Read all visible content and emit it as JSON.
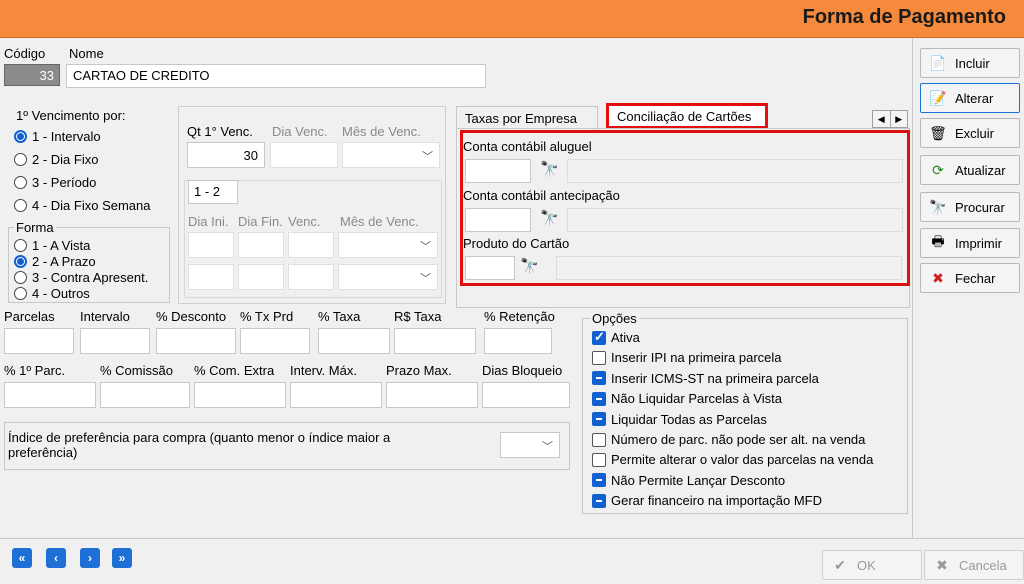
{
  "title": "Forma de Pagamento",
  "codigo": {
    "label": "Código",
    "value": "33"
  },
  "nome": {
    "label": "Nome",
    "value": "CARTAO DE CREDITO"
  },
  "vencimento": {
    "label": "1º Vencimento por:",
    "options": [
      "1 - Intervalo",
      "2 - Dia Fixo",
      "3 - Período",
      "4 - Dia Fixo Semana"
    ],
    "selected": 0
  },
  "forma": {
    "label": "Forma",
    "options": [
      "1 - A Vista",
      "2 - A Prazo",
      "3 - Contra Apresent.",
      "4 - Outros"
    ],
    "selected": 1
  },
  "qt_venc": {
    "label": "Qt 1° Venc.",
    "value": "30"
  },
  "dia_venc_label": "Dia Venc.",
  "mes_venc_label": "Mês de Venc.",
  "range_value": "1 - 2",
  "dia_ini_label": "Dia Ini.",
  "dia_fin_label": "Dia Fin.",
  "venc_label": "Venc.",
  "mes_venc2_label": "Mês de Venc.",
  "row1_labels": [
    "Parcelas",
    "Intervalo",
    "% Desconto",
    "% Tx Prd",
    "% Taxa",
    "R$ Taxa",
    "% Retenção"
  ],
  "row2_labels": [
    "% 1º Parc.",
    "% Comissão",
    "% Com. Extra",
    "Interv. Máx.",
    "Prazo Max.",
    "Dias Bloqueio"
  ],
  "indice_label": "Índice de preferência para compra (quanto menor o índice maior a preferência)",
  "tabs": [
    "Taxas por Empresa",
    "Conciliação de Cartões"
  ],
  "conciliacao": {
    "conta_aluguel": "Conta contábil aluguel",
    "conta_antecipacao": "Conta contábil antecipação",
    "produto": "Produto do Cartão"
  },
  "opcoes": {
    "label": "Opções",
    "items": [
      {
        "label": "Ativa",
        "state": "checked"
      },
      {
        "label": "Inserir IPI na primeira parcela",
        "state": "unchecked"
      },
      {
        "label": "Inserir ICMS-ST na primeira parcela",
        "state": "indeterminate"
      },
      {
        "label": "Não Liquidar Parcelas à Vista",
        "state": "indeterminate"
      },
      {
        "label": "Liquidar Todas as Parcelas",
        "state": "indeterminate"
      },
      {
        "label": "Número de parc. não pode ser alt. na venda",
        "state": "unchecked"
      },
      {
        "label": "Permite alterar o valor das parcelas na venda",
        "state": "unchecked"
      },
      {
        "label": "Não Permite Lançar Desconto",
        "state": "indeterminate"
      },
      {
        "label": "Gerar financeiro na importação MFD",
        "state": "indeterminate"
      }
    ]
  },
  "buttons": {
    "incluir": "Incluir",
    "alterar": "Alterar",
    "excluir": "Excluir",
    "atualizar": "Atualizar",
    "procurar": "Procurar",
    "imprimir": "Imprimir",
    "fechar": "Fechar",
    "ok": "OK",
    "cancela": "Cancela"
  },
  "colors": {
    "titlebar": "#f58a3c",
    "highlight": "#e01010",
    "accent": "#1060d0"
  }
}
